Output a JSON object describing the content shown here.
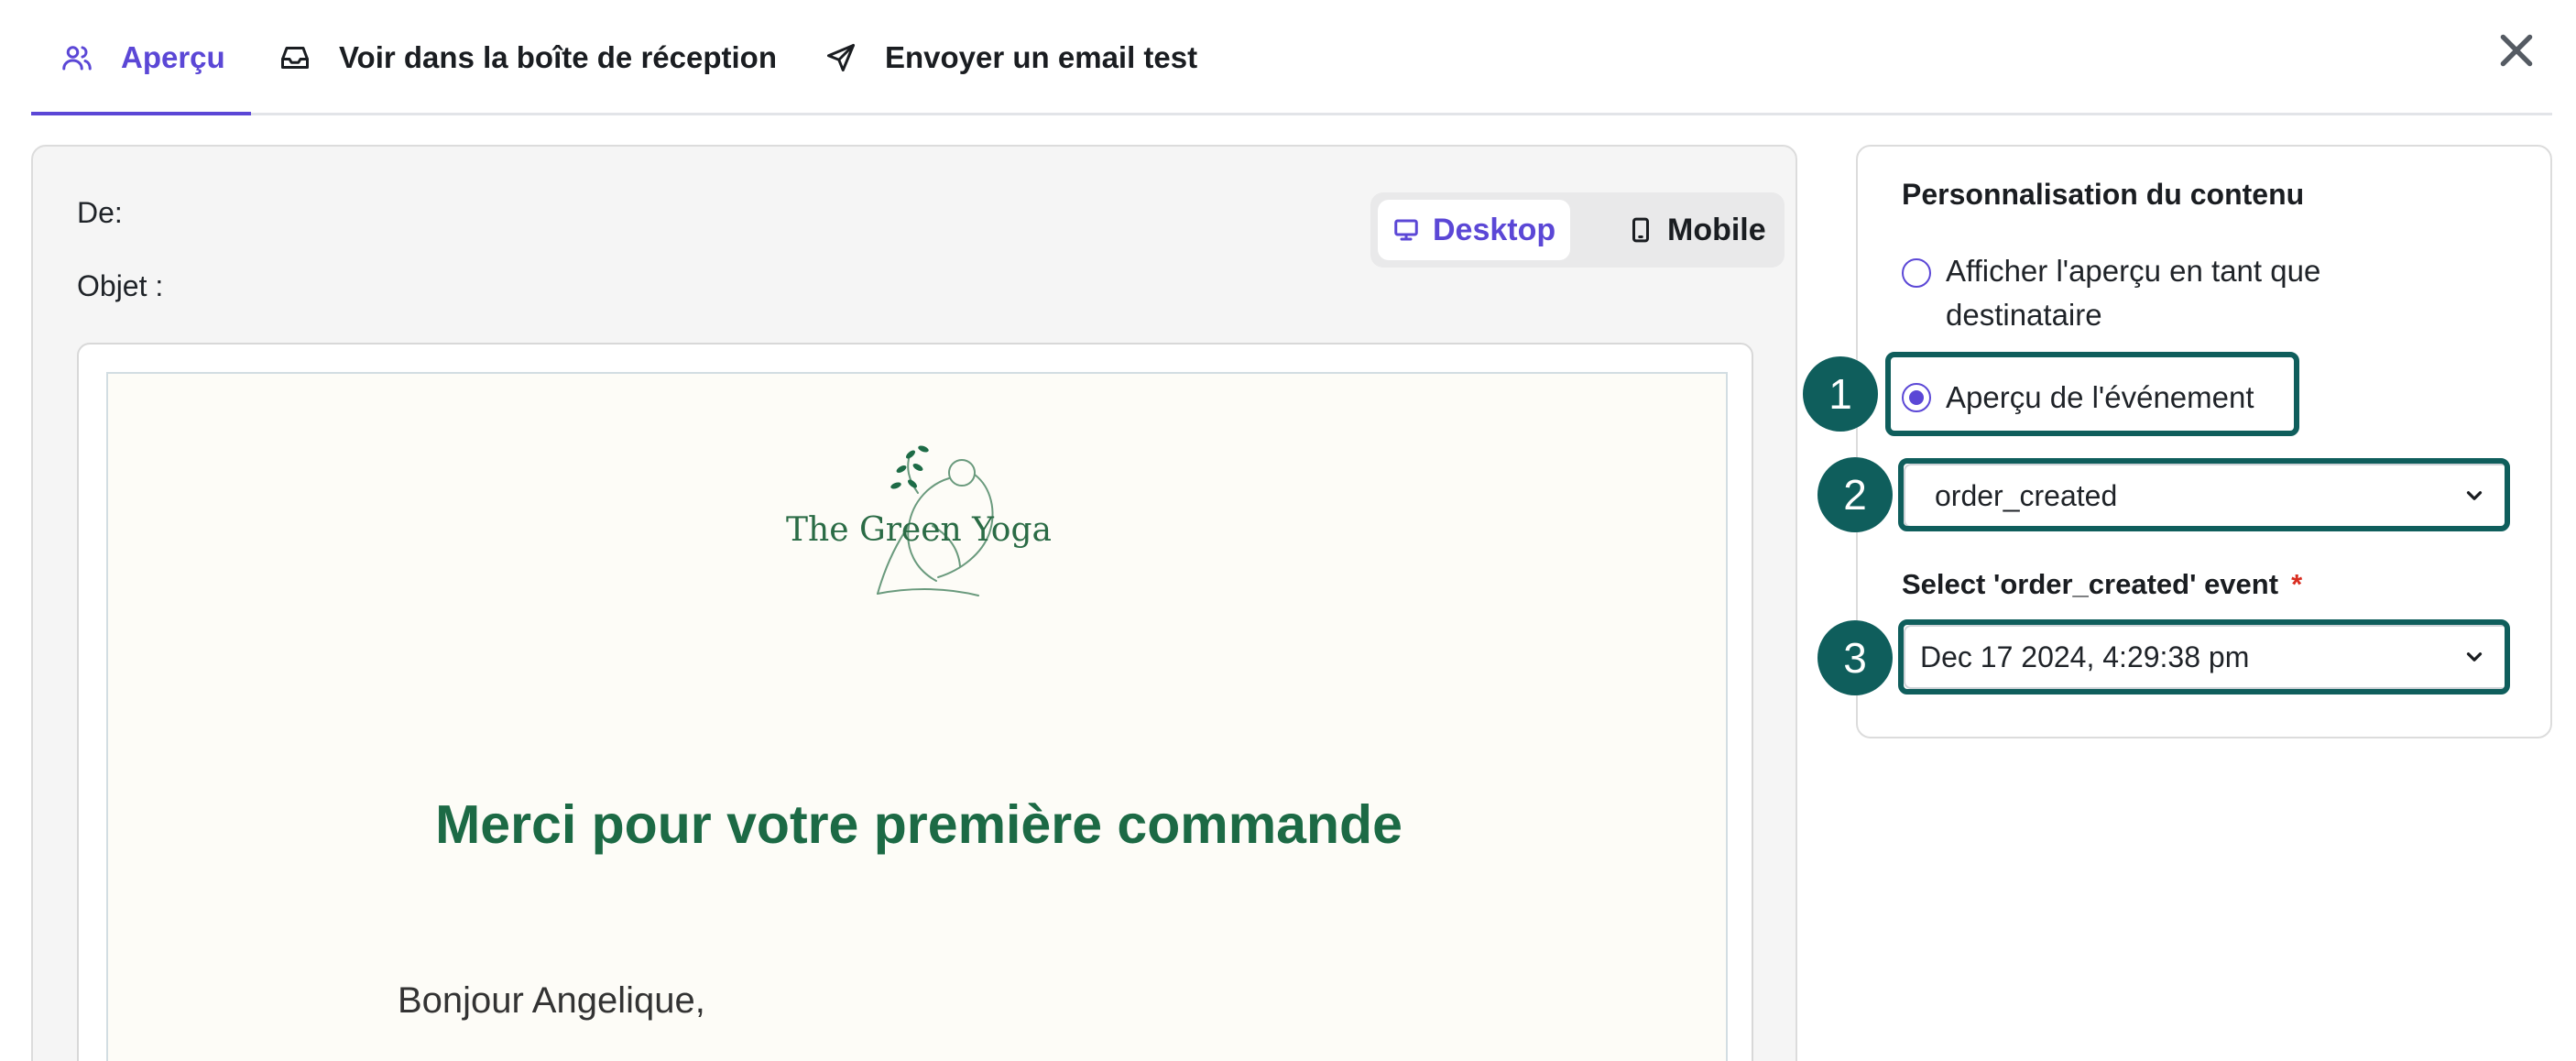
{
  "tabs": [
    {
      "label": "Aperçu",
      "icon": "users-icon",
      "active": true
    },
    {
      "label": "Voir dans la boîte de réception",
      "icon": "inbox-icon",
      "active": false
    },
    {
      "label": "Envoyer un email test",
      "icon": "send-icon",
      "active": false
    }
  ],
  "preview": {
    "from_label": "De:",
    "subject_label": "Objet :",
    "device_toggle": {
      "desktop": "Desktop",
      "mobile": "Mobile",
      "selected": "Desktop"
    },
    "email": {
      "brand": "The Green Yoga",
      "title": "Merci pour votre première commande",
      "greeting": "Bonjour Angelique,"
    }
  },
  "side_panel": {
    "title": "Personnalisation du contenu",
    "option_recipient_line1": "Afficher l'aperçu en tant que",
    "option_recipient_line2": "destinataire",
    "option_event": "Aperçu de l'événement",
    "selected_option": "event",
    "event_select_value": "order_created",
    "event_field_label": "Select 'order_created' event",
    "required_marker": "*",
    "event_instance_value": "Dec 17 2024, 4:29:38 pm"
  },
  "annotations": {
    "badge1": "1",
    "badge2": "2",
    "badge3": "3"
  },
  "colors": {
    "accent": "#5b47d6",
    "highlight": "#0f5e5c",
    "email_green": "#1c6a45",
    "required": "#d92d20"
  }
}
